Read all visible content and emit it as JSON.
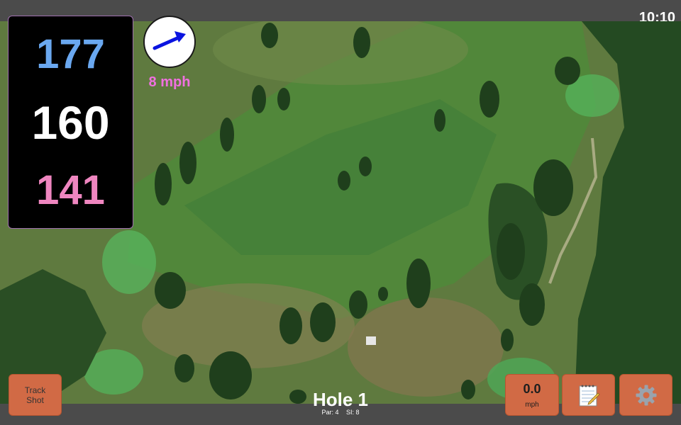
{
  "status_bar": {
    "time": "10:10"
  },
  "distances": {
    "back": "177",
    "middle": "160",
    "front": "141",
    "colors": {
      "back": "#6aa8f0",
      "middle": "#ffffff",
      "front": "#ef86c0"
    }
  },
  "wind": {
    "speed_label": "8 mph",
    "arrow_color": "#0a14e0",
    "label_color": "#f070e0",
    "direction_icon": "arrow-icon"
  },
  "hole": {
    "title": "Hole 1",
    "par": "Par: 4",
    "stroke_index": "SI: 8"
  },
  "buttons": {
    "track_shot": {
      "line1": "Track",
      "line2": "Shot"
    },
    "speed": {
      "value": "0.0",
      "unit": "mph"
    },
    "notes_icon": "notepad-icon",
    "settings_icon": "gear-icon"
  },
  "colors": {
    "button": "#d16a45",
    "bars": "#4b4b4b"
  }
}
